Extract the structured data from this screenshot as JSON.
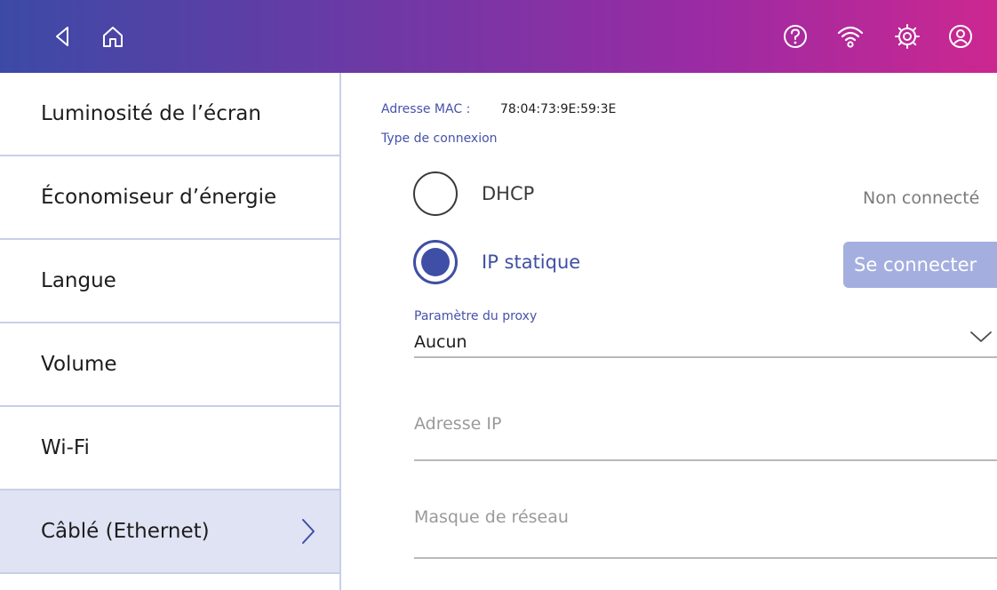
{
  "topbar": {
    "left_icons": [
      "back-icon",
      "home-icon"
    ],
    "right_icons": [
      "help-icon",
      "wifi-icon",
      "settings-icon",
      "account-icon"
    ],
    "gradient": [
      "#3c4aa6",
      "#cc2790"
    ]
  },
  "sidebar": {
    "items": [
      {
        "label": "Luminosité de l’écran"
      },
      {
        "label": "Économiseur d’énergie"
      },
      {
        "label": "Langue"
      },
      {
        "label": "Volume"
      },
      {
        "label": "Wi-Fi"
      },
      {
        "label": "Câblé (Ethernet)",
        "selected": true,
        "icon": "chevron-right-icon"
      }
    ]
  },
  "main": {
    "mac_label": "Adresse MAC :",
    "mac_value": "78:04:73:9E:59:3E",
    "connection_type_label": "Type de connexion",
    "options": {
      "dhcp": {
        "label": "DHCP",
        "selected": false,
        "status": "Non connecté"
      },
      "static": {
        "label": "IP statique",
        "selected": true,
        "button_label": "Se connecter"
      }
    },
    "proxy": {
      "label": "Paramètre du proxy",
      "value": "Aucun",
      "icon": "chevron-down-icon"
    },
    "ip_address": {
      "placeholder": "Adresse IP",
      "value": ""
    },
    "netmask": {
      "placeholder": "Masque de réseau",
      "value": ""
    }
  },
  "colors": {
    "accent": "#3f4fa6",
    "selected_bg": "#dfe3f3",
    "button_bg": "#a4afe0"
  }
}
